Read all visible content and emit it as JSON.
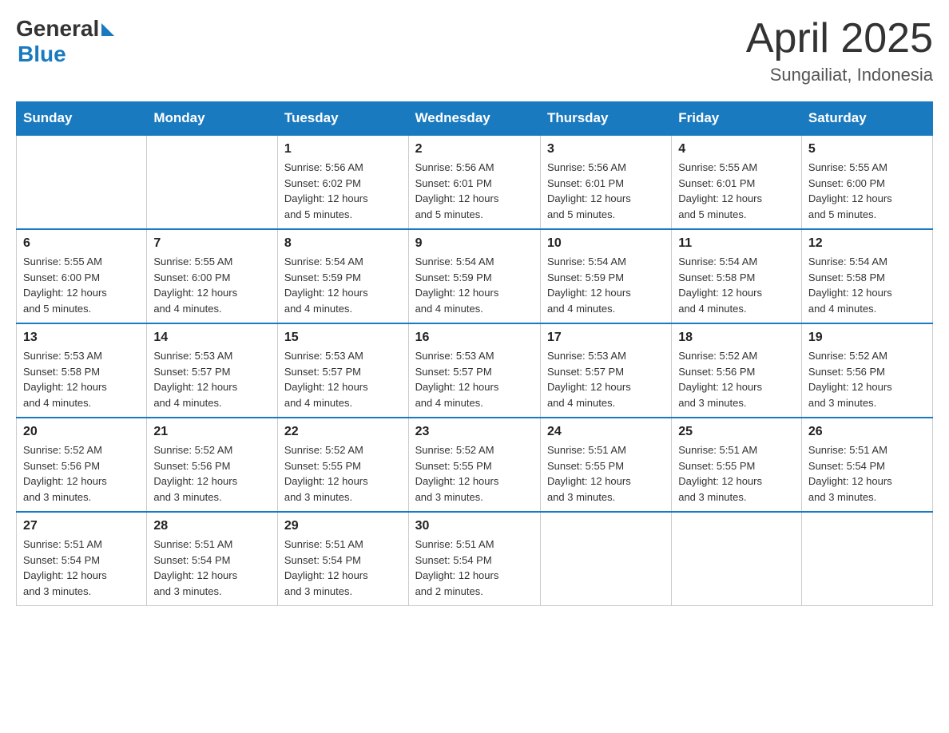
{
  "header": {
    "logo_general": "General",
    "logo_blue": "Blue",
    "title": "April 2025",
    "subtitle": "Sungailiat, Indonesia"
  },
  "calendar": {
    "days_of_week": [
      "Sunday",
      "Monday",
      "Tuesday",
      "Wednesday",
      "Thursday",
      "Friday",
      "Saturday"
    ],
    "weeks": [
      [
        {
          "day": "",
          "info": ""
        },
        {
          "day": "",
          "info": ""
        },
        {
          "day": "1",
          "info": "Sunrise: 5:56 AM\nSunset: 6:02 PM\nDaylight: 12 hours\nand 5 minutes."
        },
        {
          "day": "2",
          "info": "Sunrise: 5:56 AM\nSunset: 6:01 PM\nDaylight: 12 hours\nand 5 minutes."
        },
        {
          "day": "3",
          "info": "Sunrise: 5:56 AM\nSunset: 6:01 PM\nDaylight: 12 hours\nand 5 minutes."
        },
        {
          "day": "4",
          "info": "Sunrise: 5:55 AM\nSunset: 6:01 PM\nDaylight: 12 hours\nand 5 minutes."
        },
        {
          "day": "5",
          "info": "Sunrise: 5:55 AM\nSunset: 6:00 PM\nDaylight: 12 hours\nand 5 minutes."
        }
      ],
      [
        {
          "day": "6",
          "info": "Sunrise: 5:55 AM\nSunset: 6:00 PM\nDaylight: 12 hours\nand 5 minutes."
        },
        {
          "day": "7",
          "info": "Sunrise: 5:55 AM\nSunset: 6:00 PM\nDaylight: 12 hours\nand 4 minutes."
        },
        {
          "day": "8",
          "info": "Sunrise: 5:54 AM\nSunset: 5:59 PM\nDaylight: 12 hours\nand 4 minutes."
        },
        {
          "day": "9",
          "info": "Sunrise: 5:54 AM\nSunset: 5:59 PM\nDaylight: 12 hours\nand 4 minutes."
        },
        {
          "day": "10",
          "info": "Sunrise: 5:54 AM\nSunset: 5:59 PM\nDaylight: 12 hours\nand 4 minutes."
        },
        {
          "day": "11",
          "info": "Sunrise: 5:54 AM\nSunset: 5:58 PM\nDaylight: 12 hours\nand 4 minutes."
        },
        {
          "day": "12",
          "info": "Sunrise: 5:54 AM\nSunset: 5:58 PM\nDaylight: 12 hours\nand 4 minutes."
        }
      ],
      [
        {
          "day": "13",
          "info": "Sunrise: 5:53 AM\nSunset: 5:58 PM\nDaylight: 12 hours\nand 4 minutes."
        },
        {
          "day": "14",
          "info": "Sunrise: 5:53 AM\nSunset: 5:57 PM\nDaylight: 12 hours\nand 4 minutes."
        },
        {
          "day": "15",
          "info": "Sunrise: 5:53 AM\nSunset: 5:57 PM\nDaylight: 12 hours\nand 4 minutes."
        },
        {
          "day": "16",
          "info": "Sunrise: 5:53 AM\nSunset: 5:57 PM\nDaylight: 12 hours\nand 4 minutes."
        },
        {
          "day": "17",
          "info": "Sunrise: 5:53 AM\nSunset: 5:57 PM\nDaylight: 12 hours\nand 4 minutes."
        },
        {
          "day": "18",
          "info": "Sunrise: 5:52 AM\nSunset: 5:56 PM\nDaylight: 12 hours\nand 3 minutes."
        },
        {
          "day": "19",
          "info": "Sunrise: 5:52 AM\nSunset: 5:56 PM\nDaylight: 12 hours\nand 3 minutes."
        }
      ],
      [
        {
          "day": "20",
          "info": "Sunrise: 5:52 AM\nSunset: 5:56 PM\nDaylight: 12 hours\nand 3 minutes."
        },
        {
          "day": "21",
          "info": "Sunrise: 5:52 AM\nSunset: 5:56 PM\nDaylight: 12 hours\nand 3 minutes."
        },
        {
          "day": "22",
          "info": "Sunrise: 5:52 AM\nSunset: 5:55 PM\nDaylight: 12 hours\nand 3 minutes."
        },
        {
          "day": "23",
          "info": "Sunrise: 5:52 AM\nSunset: 5:55 PM\nDaylight: 12 hours\nand 3 minutes."
        },
        {
          "day": "24",
          "info": "Sunrise: 5:51 AM\nSunset: 5:55 PM\nDaylight: 12 hours\nand 3 minutes."
        },
        {
          "day": "25",
          "info": "Sunrise: 5:51 AM\nSunset: 5:55 PM\nDaylight: 12 hours\nand 3 minutes."
        },
        {
          "day": "26",
          "info": "Sunrise: 5:51 AM\nSunset: 5:54 PM\nDaylight: 12 hours\nand 3 minutes."
        }
      ],
      [
        {
          "day": "27",
          "info": "Sunrise: 5:51 AM\nSunset: 5:54 PM\nDaylight: 12 hours\nand 3 minutes."
        },
        {
          "day": "28",
          "info": "Sunrise: 5:51 AM\nSunset: 5:54 PM\nDaylight: 12 hours\nand 3 minutes."
        },
        {
          "day": "29",
          "info": "Sunrise: 5:51 AM\nSunset: 5:54 PM\nDaylight: 12 hours\nand 3 minutes."
        },
        {
          "day": "30",
          "info": "Sunrise: 5:51 AM\nSunset: 5:54 PM\nDaylight: 12 hours\nand 2 minutes."
        },
        {
          "day": "",
          "info": ""
        },
        {
          "day": "",
          "info": ""
        },
        {
          "day": "",
          "info": ""
        }
      ]
    ]
  }
}
